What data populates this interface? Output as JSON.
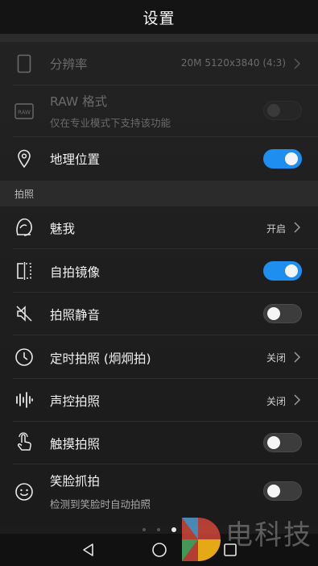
{
  "header": {
    "title": "设置"
  },
  "rows_top": [
    {
      "id": "resolution",
      "label": "分辨率",
      "value": "20M 5120x3840 (4:3)",
      "disabled": true
    },
    {
      "id": "raw",
      "label": "RAW 格式",
      "sub": "仅在专业模式下支持该功能",
      "disabled": true,
      "toggle": "disabled"
    },
    {
      "id": "location",
      "label": "地理位置",
      "toggle": "on"
    }
  ],
  "section_photo": {
    "label": "拍照"
  },
  "rows_photo": [
    {
      "id": "beauty",
      "label": "魅我",
      "value": "开启"
    },
    {
      "id": "mirror",
      "label": "自拍镜像",
      "toggle": "on"
    },
    {
      "id": "mute",
      "label": "拍照静音",
      "toggle": "off"
    },
    {
      "id": "timer",
      "label": "定时拍照 (炯炯拍)",
      "value": "关闭"
    },
    {
      "id": "voice",
      "label": "声控拍照",
      "value": "关闭"
    },
    {
      "id": "touch",
      "label": "触摸拍照",
      "toggle": "off"
    },
    {
      "id": "smile",
      "label": "笑脸抓拍",
      "sub": "检测到笑脸时自动拍照",
      "toggle": "off"
    }
  ],
  "watermark": {
    "text": "电科技"
  },
  "colors": {
    "accent": "#1e8ef0",
    "background": "#1c1c1c"
  }
}
